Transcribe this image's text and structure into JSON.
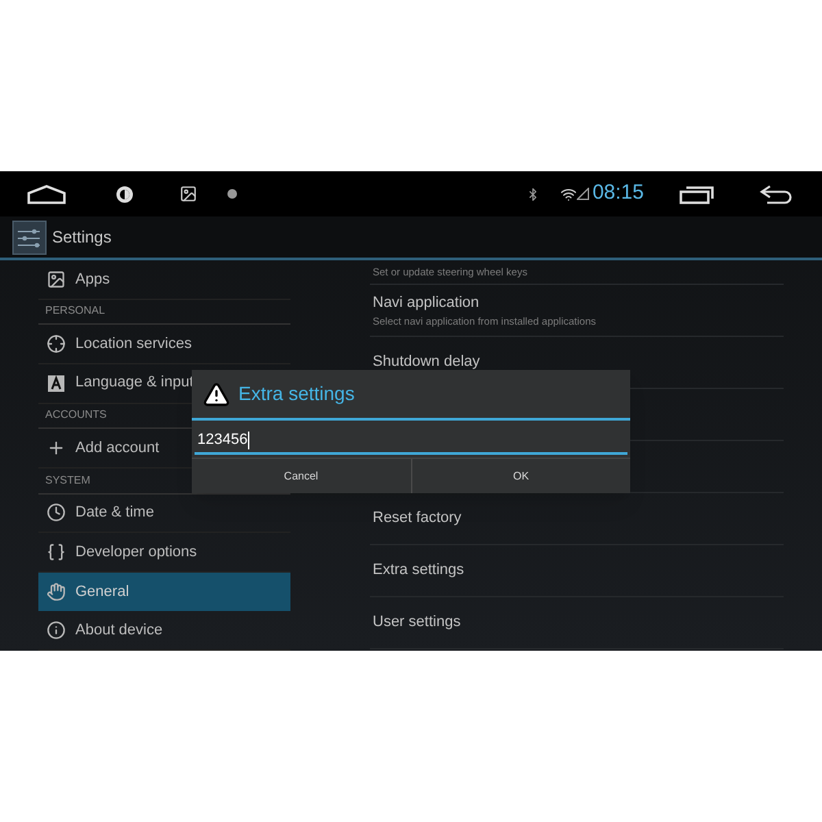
{
  "status_bar": {
    "time": "08:15"
  },
  "action_bar": {
    "title": "Settings"
  },
  "sidebar": {
    "items": [
      {
        "kind": "item",
        "label": "Apps",
        "selected": false
      },
      {
        "kind": "header",
        "label": "PERSONAL"
      },
      {
        "kind": "item",
        "label": "Location services",
        "selected": false
      },
      {
        "kind": "item",
        "label": "Language & input",
        "selected": false
      },
      {
        "kind": "header",
        "label": "ACCOUNTS"
      },
      {
        "kind": "item",
        "label": "Add account",
        "selected": false
      },
      {
        "kind": "header",
        "label": "SYSTEM"
      },
      {
        "kind": "item",
        "label": "Date & time",
        "selected": false
      },
      {
        "kind": "item",
        "label": "Developer options",
        "selected": false
      },
      {
        "kind": "item",
        "label": "General",
        "selected": true
      },
      {
        "kind": "item",
        "label": "About device",
        "selected": false
      }
    ]
  },
  "content": {
    "items": [
      {
        "subtitle": "Set or update steering wheel keys"
      },
      {
        "title": "Navi application",
        "subtitle": "Select navi application from installed applications"
      },
      {
        "title": "Shutdown delay"
      },
      {
        "title": "Reset factory"
      },
      {
        "title": "Extra settings"
      },
      {
        "title": "User settings"
      }
    ]
  },
  "dialog": {
    "title": "Extra settings",
    "input": {
      "value": "123456",
      "focused": true
    },
    "buttons": [
      "Cancel",
      "OK"
    ]
  }
}
